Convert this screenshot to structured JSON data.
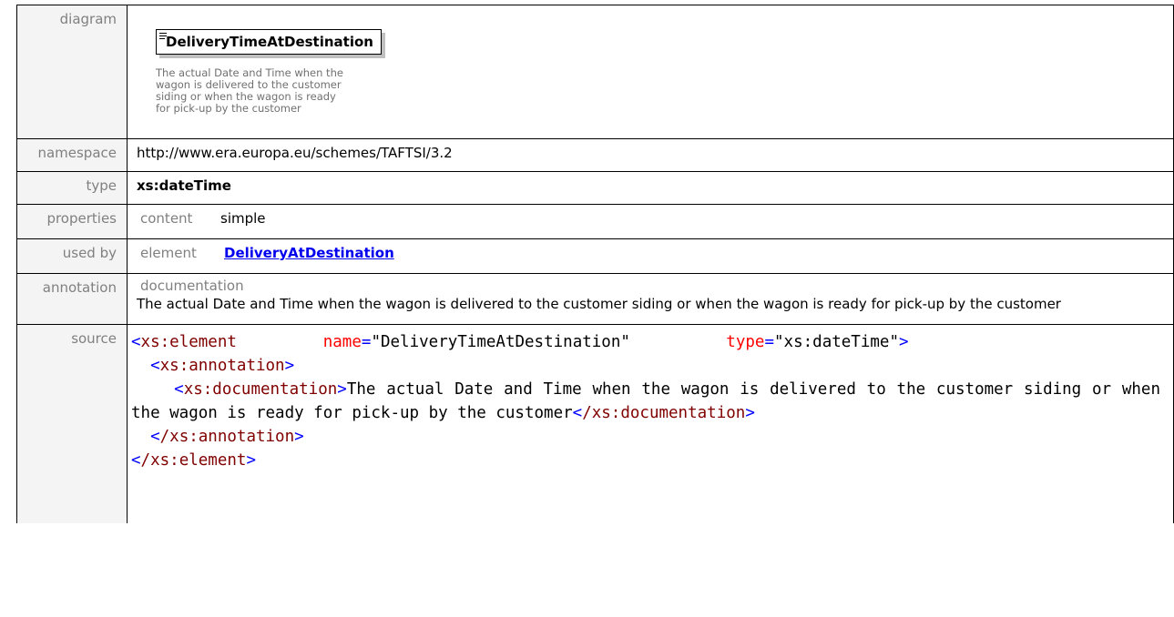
{
  "labels": {
    "diagram": "diagram",
    "namespace": "namespace",
    "type": "type",
    "properties": "properties",
    "used_by": "used by",
    "annotation": "annotation",
    "source": "source"
  },
  "diagram": {
    "element_name": "DeliveryTimeAtDestination",
    "description": "The actual Date and Time when the wagon is delivered to the customer siding or when the wagon is ready for pick-up by the customer"
  },
  "namespace": "http://www.era.europa.eu/schemes/TAFTSI/3.2",
  "type": "xs:dateTime",
  "properties": {
    "label": "content",
    "value": "simple"
  },
  "used_by": {
    "label": "element",
    "link": "DeliveryAtDestination"
  },
  "annotation": {
    "label": "documentation",
    "text": "The actual Date and Time when the wagon is delivered to the customer siding or when the wagon is ready for pick-up by the customer"
  },
  "source": {
    "open_tag": "xs:element",
    "attr_name": "name",
    "attr_name_value": "DeliveryTimeAtDestination",
    "attr_type": "type",
    "attr_type_value": "xs:dateTime",
    "annotation_tag": "xs:annotation",
    "documentation_tag": "xs:documentation",
    "documentation_text": "The actual Date and Time when the wagon is delivered to the customer siding or when the wagon is ready for pick-up by the customer",
    "close_documentation_tag": "/xs:documentation",
    "close_annotation_tag": "/xs:annotation",
    "close_element_tag": "/xs:element"
  },
  "colors": {
    "label_bg": "#f4f4f4",
    "label_text": "#808080",
    "link": "#0000ee",
    "xml_tag": "#800000",
    "xml_punct": "#0000ff",
    "xml_attr": "#ff0000"
  }
}
